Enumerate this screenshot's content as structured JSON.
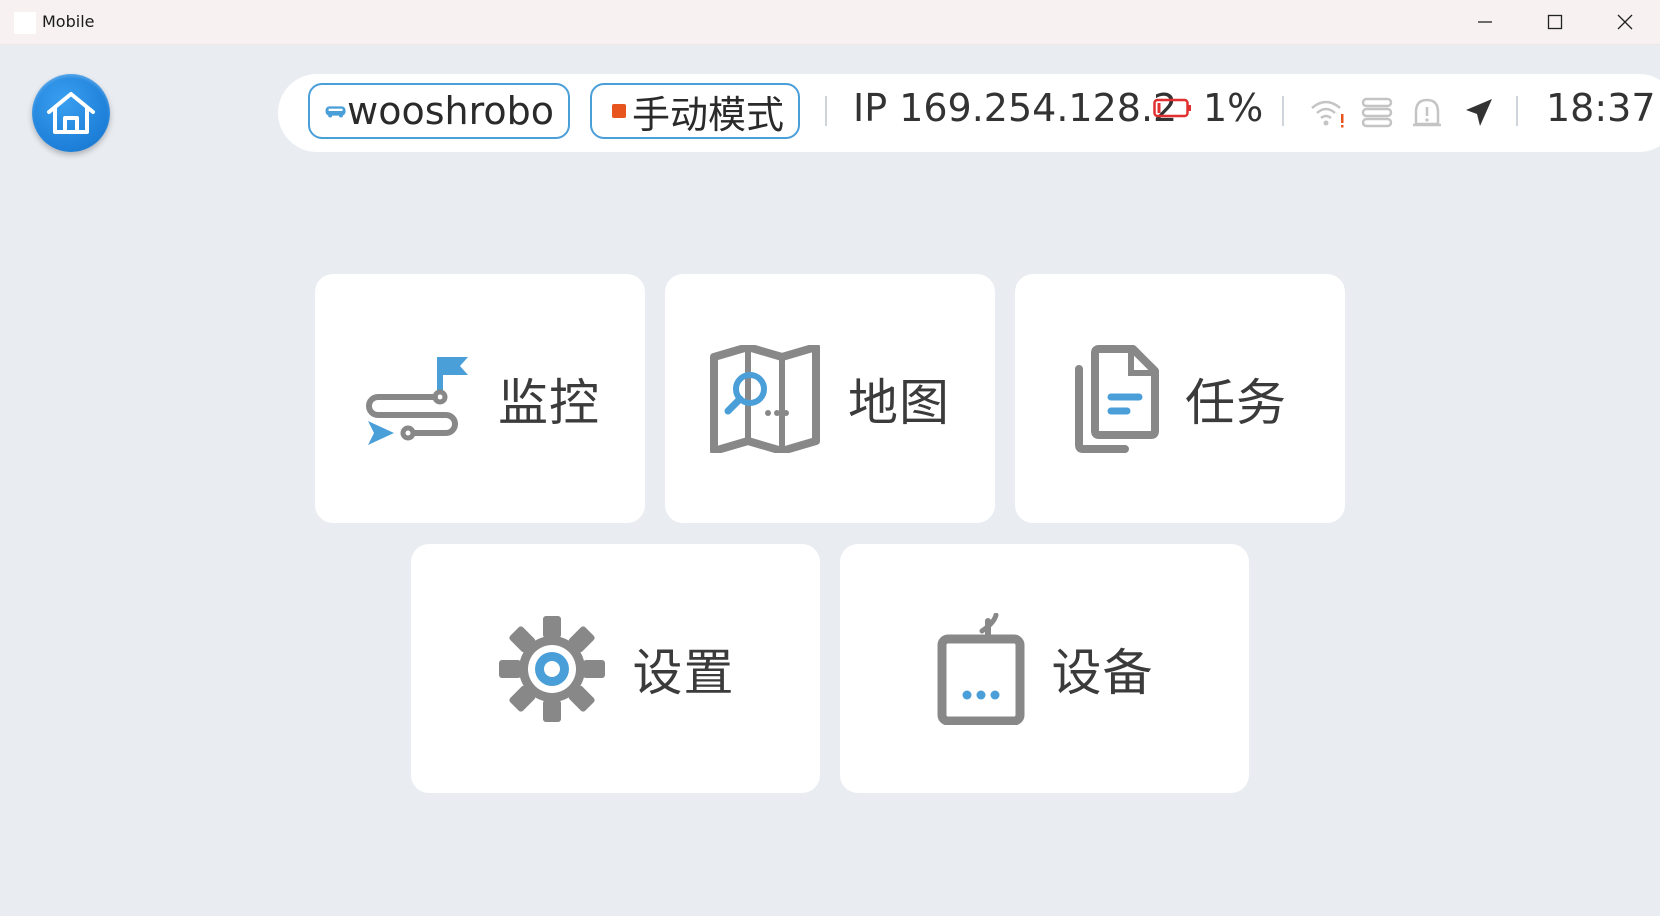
{
  "window": {
    "title": "Mobile"
  },
  "status": {
    "robot_name": "wooshrobo",
    "mode": "手动模式",
    "ip": "IP 169.254.128.2",
    "battery_percent": "1%",
    "time": "18:37"
  },
  "menu": {
    "monitor": "监控",
    "map": "地图",
    "task": "任务",
    "settings": "设置",
    "device": "设备"
  },
  "colors": {
    "accent": "#4a9fd8",
    "icon_gray": "#888888",
    "mode_indicator": "#e8541d",
    "battery_low": "#e03030",
    "background": "#e9edf2"
  },
  "icons": {
    "home": "home-icon",
    "robot": "robot-icon",
    "battery": "battery-icon",
    "wifi": "wifi-warning-icon",
    "server": "server-icon",
    "alert": "alert-icon",
    "navigation": "navigation-arrow-icon",
    "monitor": "route-flag-icon",
    "map": "map-search-icon",
    "task": "documents-icon",
    "settings": "gear-icon",
    "device": "device-icon"
  }
}
